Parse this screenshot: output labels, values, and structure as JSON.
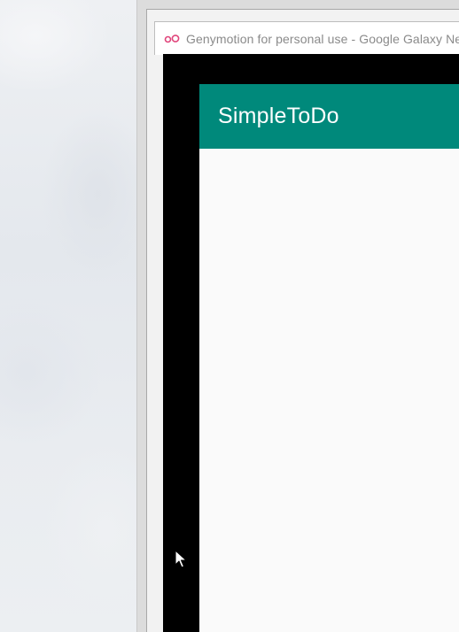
{
  "window": {
    "title": "Genymotion for personal use - Google Galaxy Nexus"
  },
  "app": {
    "title": "SimpleToDo",
    "primary_color": "#00897b",
    "background_color": "#fafafa"
  },
  "colors": {
    "logo": "#e0457b",
    "device_bezel": "#000000"
  },
  "icons": {
    "logo": "genymotion-logo-icon",
    "pointer": "mouse-pointer-icon"
  }
}
